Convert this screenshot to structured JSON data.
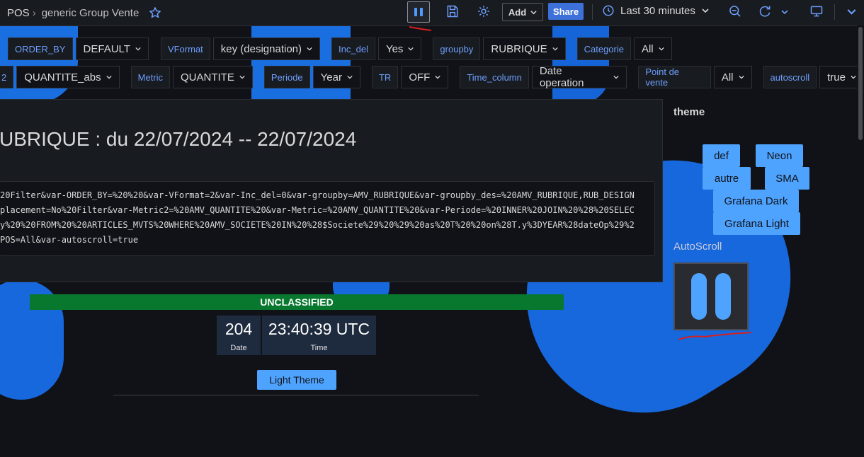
{
  "breadcrumb": {
    "root": "POS",
    "dashboard": "generic Group Vente"
  },
  "toolbar": {
    "add_label": "Add",
    "share_label": "Share",
    "time_range": "Last 30 minutes"
  },
  "variables_row1": [
    {
      "label": "ORDER_BY",
      "value": "DEFAULT"
    },
    {
      "label": "VFormat",
      "value": "key (designation)"
    },
    {
      "label": "Inc_del",
      "value": "Yes"
    },
    {
      "label": "groupby",
      "value": "RUBRIQUE"
    },
    {
      "label": "Categorie",
      "value": "All"
    }
  ],
  "variables_row2": [
    {
      "label": "2",
      "value": "QUANTITE_abs"
    },
    {
      "label": "Metric",
      "value": "QUANTITE"
    },
    {
      "label": "Periode",
      "value": "Year"
    },
    {
      "label": "TR",
      "value": "OFF"
    },
    {
      "label": "Time_column",
      "value": "Date operation"
    },
    {
      "label": "Point de vente",
      "value": "All"
    },
    {
      "label": "autoscroll",
      "value": "true"
    }
  ],
  "panel": {
    "title": "UBRIQUE : du 22/07/2024 -- 22/07/2024",
    "code_lines": [
      "20Filter&var-ORDER_BY=%20%20&var-VFormat=2&var-Inc_del=0&var-groupby=AMV_RUBRIQUE&var-groupby_des=%20AMV_RUBRIQUE,RUB_DESIGN",
      "placement=No%20Filter&var-Metric2=%20AMV_QUANTITE%20&var-Metric=%20AMV_QUANTITE%20&var-Periode=%20INNER%20JOIN%20%28%20SELEC",
      "y%20%20FROM%20%20ARTICLES_MVTS%20WHERE%20AMV_SOCIETE%20IN%20%28$Societe%29%20%29%20as%20T%20%20on%28T.y%3DYEAR%28dateOp%29%2",
      "POS=All&var-autoscroll=true"
    ]
  },
  "theme": {
    "heading": "theme",
    "buttons": [
      "def",
      "Neon",
      "autre",
      "SMA",
      "Grafana Dark",
      "Grafana Light"
    ]
  },
  "autoscroll": {
    "heading": "AutoScroll"
  },
  "banner": {
    "text": "UNCLASSIFIED",
    "color": "#08782f"
  },
  "clock": {
    "date_value": "204",
    "date_label": "Date",
    "time_value": "23:40:39 UTC",
    "time_label": "Time"
  },
  "light_theme_label": "Light Theme",
  "colors": {
    "accent": "#4ea3ff",
    "brand_blue": "#1a6fe0",
    "share": "#3d71d9"
  }
}
